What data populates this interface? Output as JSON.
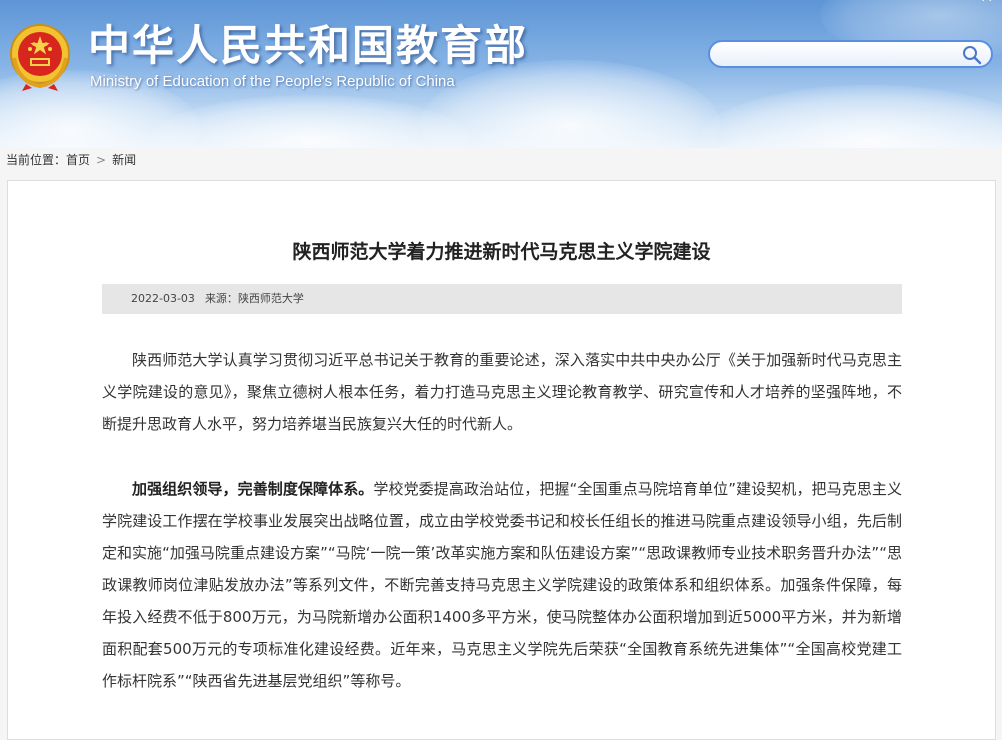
{
  "header": {
    "title": "中华人民共和国教育部",
    "subtitle": "Ministry of Education of the People's Republic of China",
    "top_links": "· ·",
    "search": {
      "placeholder": ""
    }
  },
  "breadcrumb": {
    "label": "当前位置：",
    "items": [
      "首页",
      "新闻"
    ],
    "separator": ">"
  },
  "article": {
    "title": "陕西师范大学着力推进新时代马克思主义学院建设",
    "date": "2022-03-03",
    "source_label": "来源：",
    "source": "陕西师范大学",
    "paragraph1": "陕西师范大学认真学习贯彻习近平总书记关于教育的重要论述，深入落实中共中央办公厅《关于加强新时代马克思主义学院建设的意见》，聚焦立德树人根本任务，着力打造马克思主义理论教育教学、研究宣传和人才培养的坚强阵地，不断提升思政育人水平，努力培养堪当民族复兴大任的时代新人。",
    "paragraph2_lead": "加强组织领导，完善制度保障体系。",
    "paragraph2_body": "学校党委提高政治站位，把握“全国重点马院培育单位”建设契机，把马克思主义学院建设工作摆在学校事业发展突出战略位置，成立由学校党委书记和校长任组长的推进马院重点建设领导小组，先后制定和实施“加强马院重点建设方案”“马院‘一院一策’改革实施方案和队伍建设方案”“思政课教师专业技术职务晋升办法”“思政课教师岗位津贴发放办法”等系列文件，不断完善支持马克思主义学院建设的政策体系和组织体系。加强条件保障，每年投入经费不低于800万元，为马院新增办公面积1400多平方米，使马院整体办公面积增加到近5000平方米，并为新增面积配套500万元的专项标准化建设经费。近年来，马克思主义学院先后荣获“全国教育系统先进集体”“全国高校党建工作标杆院系”“陕西省先进基层党组织”等称号。"
  },
  "colors": {
    "banner_top": "#5d95d6",
    "banner_bottom": "#e6f0fb",
    "search_border": "#5a8ee0",
    "meta_bar": "#e6e6e6",
    "text": "#333333"
  },
  "icons": {
    "emblem": "national-emblem-icon",
    "search": "search-icon"
  }
}
